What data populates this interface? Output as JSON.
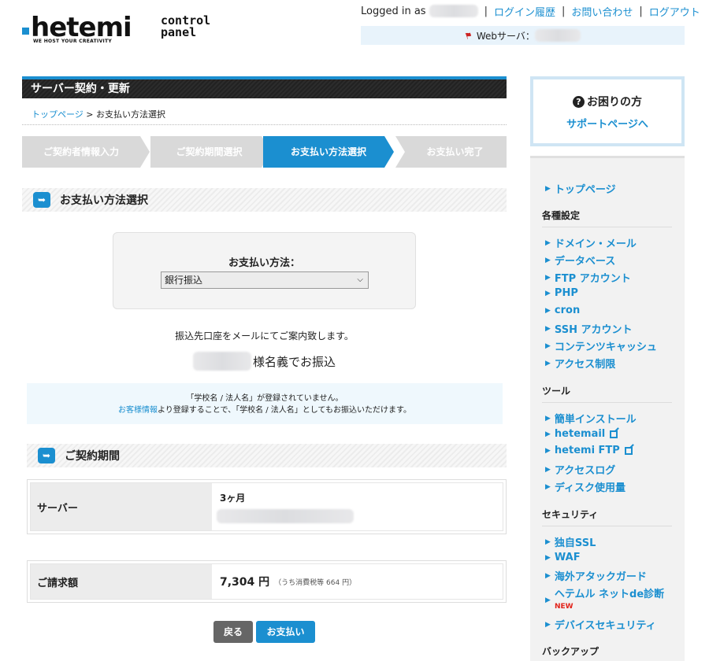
{
  "header": {
    "logo_text": "hetemi",
    "logo_tagline": "WE HOST YOUR CREATIVITY",
    "logo_sub": "control panel",
    "logged_in_label": "Logged in as",
    "links": [
      "ログイン履歴",
      "お問い合わせ",
      "ログアウト"
    ],
    "server_label": "Webサーバ："
  },
  "page": {
    "title": "サーバー契約・更新",
    "breadcrumb_top": "トップページ",
    "breadcrumb_sep": ">",
    "breadcrumb_current": "お支払い方法選択"
  },
  "steps": [
    {
      "label": "ご契約者情報入力",
      "active": false
    },
    {
      "label": "ご契約期間選択",
      "active": false
    },
    {
      "label": "お支払い方法選択",
      "active": true
    },
    {
      "label": "お支払い完了",
      "active": false
    }
  ],
  "payment_section": {
    "heading": "お支払い方法選択",
    "method_label": "お支払い方法：",
    "method_value": "銀行振込",
    "mail_notice": "振込先口座をメールにてご案内致します。",
    "holder_suffix": "様名義でお振込",
    "info_line1": "「学校名 / 法人名」が登録されていません。",
    "info_link": "お客様情報",
    "info_line2_rest": "より登録することで、「学校名 / 法人名」としてもお振込いただけます。"
  },
  "contract_section": {
    "heading": "ご契約期間",
    "server_label": "サーバー",
    "server_period": "3ヶ月",
    "billing_label": "ご請求額",
    "billing_amount": "7,304 円",
    "billing_tax": "（うち消費税等 664 円）"
  },
  "buttons": {
    "back": "戻る",
    "pay": "お支払い"
  },
  "sidebar": {
    "help_title": "お困りの方",
    "help_link": "サポートページへ",
    "top_link": "トップページ",
    "groups": [
      {
        "title": "各種設定",
        "items": [
          "ドメイン・メール",
          "データベース",
          "FTP アカウント",
          "PHP",
          "cron",
          "SSH アカウント",
          "コンテンツキャッシュ",
          "アクセス制限"
        ]
      },
      {
        "title": "ツール",
        "items": [
          "簡単インストール",
          "hetemail",
          "hetemi FTP",
          "アクセスログ",
          "ディスク使用量"
        ]
      },
      {
        "title": "セキュリティ",
        "items": [
          "独自SSL",
          "WAF",
          "海外アタックガード",
          "ヘテムル ネットde診断",
          "デバイスセキュリティ"
        ]
      },
      {
        "title": "バックアップ",
        "items": []
      }
    ],
    "new_badge": "NEW"
  },
  "colors": {
    "accent": "#1b8fd0",
    "step_inactive": "#d9d9d9",
    "back_button": "#666666",
    "new_badge": "#e2231a"
  }
}
